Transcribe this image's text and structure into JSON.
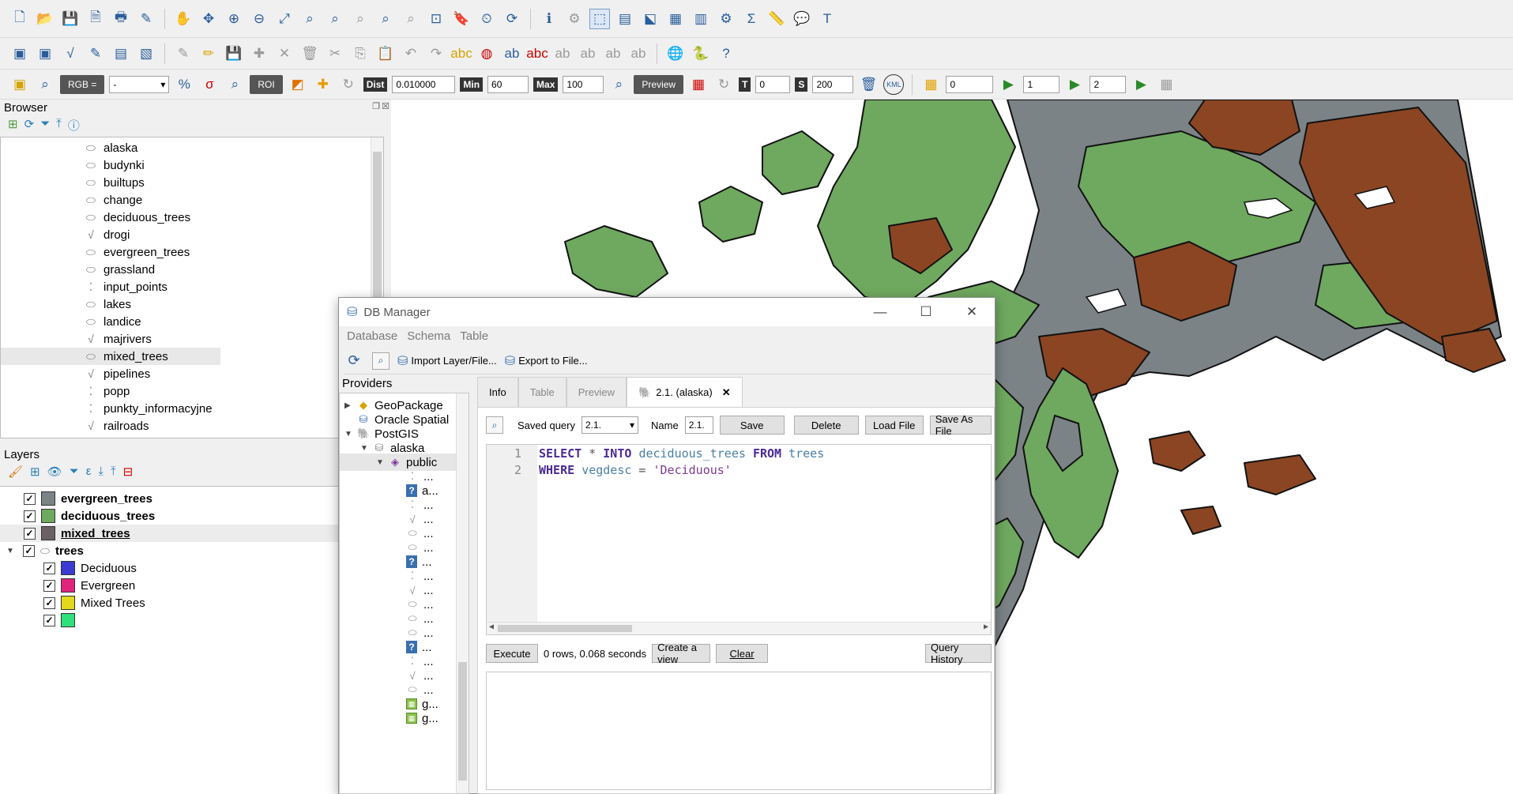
{
  "browser": {
    "title": "Browser",
    "items": [
      {
        "label": "alaska",
        "icon": "polygon-layer-icon"
      },
      {
        "label": "budynki",
        "icon": "polygon-layer-icon"
      },
      {
        "label": "builtups",
        "icon": "polygon-layer-icon"
      },
      {
        "label": "change",
        "icon": "polygon-layer-icon"
      },
      {
        "label": "deciduous_trees",
        "icon": "polygon-layer-icon"
      },
      {
        "label": "drogi",
        "icon": "line-layer-icon"
      },
      {
        "label": "evergreen_trees",
        "icon": "polygon-layer-icon"
      },
      {
        "label": "grassland",
        "icon": "polygon-layer-icon"
      },
      {
        "label": "input_points",
        "icon": "point-layer-icon"
      },
      {
        "label": "lakes",
        "icon": "polygon-layer-icon"
      },
      {
        "label": "landice",
        "icon": "polygon-layer-icon"
      },
      {
        "label": "majrivers",
        "icon": "line-layer-icon"
      },
      {
        "label": "mixed_trees",
        "icon": "polygon-layer-icon"
      },
      {
        "label": "pipelines",
        "icon": "line-layer-icon"
      },
      {
        "label": "popp",
        "icon": "point-layer-icon"
      },
      {
        "label": "punkty_informacyjne",
        "icon": "point-layer-icon"
      },
      {
        "label": "railroads",
        "icon": "line-layer-icon"
      }
    ]
  },
  "layers": {
    "title": "Layers",
    "items": [
      {
        "label": "evergreen_trees",
        "color": "#7b8387",
        "checked": "✓"
      },
      {
        "label": "deciduous_trees",
        "color": "#6fa85f",
        "checked": "✓"
      },
      {
        "label": "mixed_trees",
        "color": "#6b6066",
        "checked": "✓"
      },
      {
        "label": "trees",
        "checked": "✓"
      }
    ],
    "categories": [
      {
        "label": "Deciduous",
        "color": "#3b3bd1",
        "checked": "✓"
      },
      {
        "label": "Evergreen",
        "color": "#e0247d",
        "checked": "✓"
      },
      {
        "label": "Mixed Trees",
        "color": "#e3d81c",
        "checked": "✓"
      },
      {
        "label": "",
        "color": "#2fe07b",
        "checked": "✓"
      }
    ]
  },
  "toolbar3": {
    "rgb_label": "RGB =",
    "rgb_value": "-",
    "roi_label": "ROI",
    "dist_label": "Dist",
    "dist_value": "0.010000",
    "min_label": "Min",
    "min_value": "60",
    "max_label": "Max",
    "max_value": "100",
    "preview_label": "Preview",
    "t_label": "T",
    "t_value": "0",
    "s_label": "S",
    "s_value": "200",
    "kml_label": "KML",
    "spin1": "0",
    "spin2": "1",
    "spin3": "2"
  },
  "map_colors": {
    "deciduous": "#6fa85f",
    "evergreen": "#7b8387",
    "mixed": "#8b4523"
  },
  "dbmanager": {
    "title": "DB Manager",
    "menu": [
      "Database",
      "Schema",
      "Table"
    ],
    "import_label": "Import Layer/File...",
    "export_label": "Export to File...",
    "providers_title": "Providers",
    "providers": [
      {
        "label": "GeoPackage"
      },
      {
        "label": "Oracle Spatial"
      },
      {
        "label": "PostGIS"
      },
      {
        "label": "alaska"
      },
      {
        "label": "public"
      }
    ],
    "tables": [
      "...",
      "a...",
      "...",
      "...",
      "...",
      "...",
      "...",
      "...",
      "...",
      "...",
      "...",
      "...",
      "...",
      "...",
      "...",
      "...",
      "g...",
      "g..."
    ],
    "tabs": [
      "Info",
      "Table",
      "Preview",
      "2.1. (alaska)"
    ],
    "saved_query_label": "Saved query",
    "saved_query_value": "2.1.",
    "name_label": "Name",
    "name_value": "2.1.",
    "save_label": "Save",
    "delete_label": "Delete",
    "load_label": "Load File",
    "saveas_label": "Save As File",
    "sql_line1": {
      "n": "1",
      "kw1": "SELECT",
      "op": " * ",
      "kw2": "INTO",
      "id1": "deciduous_trees",
      "kw3": "FROM",
      "id2": "trees"
    },
    "sql_line2": {
      "n": "2",
      "kw1": "WHERE",
      "id1": "vegdesc",
      "op": " = ",
      "str": "'Deciduous'"
    },
    "execute_label": "Execute",
    "status": "0 rows, 0.068 seconds",
    "create_view_label": "Create a view",
    "clear_label": "Clear",
    "history_label": "Query History"
  }
}
